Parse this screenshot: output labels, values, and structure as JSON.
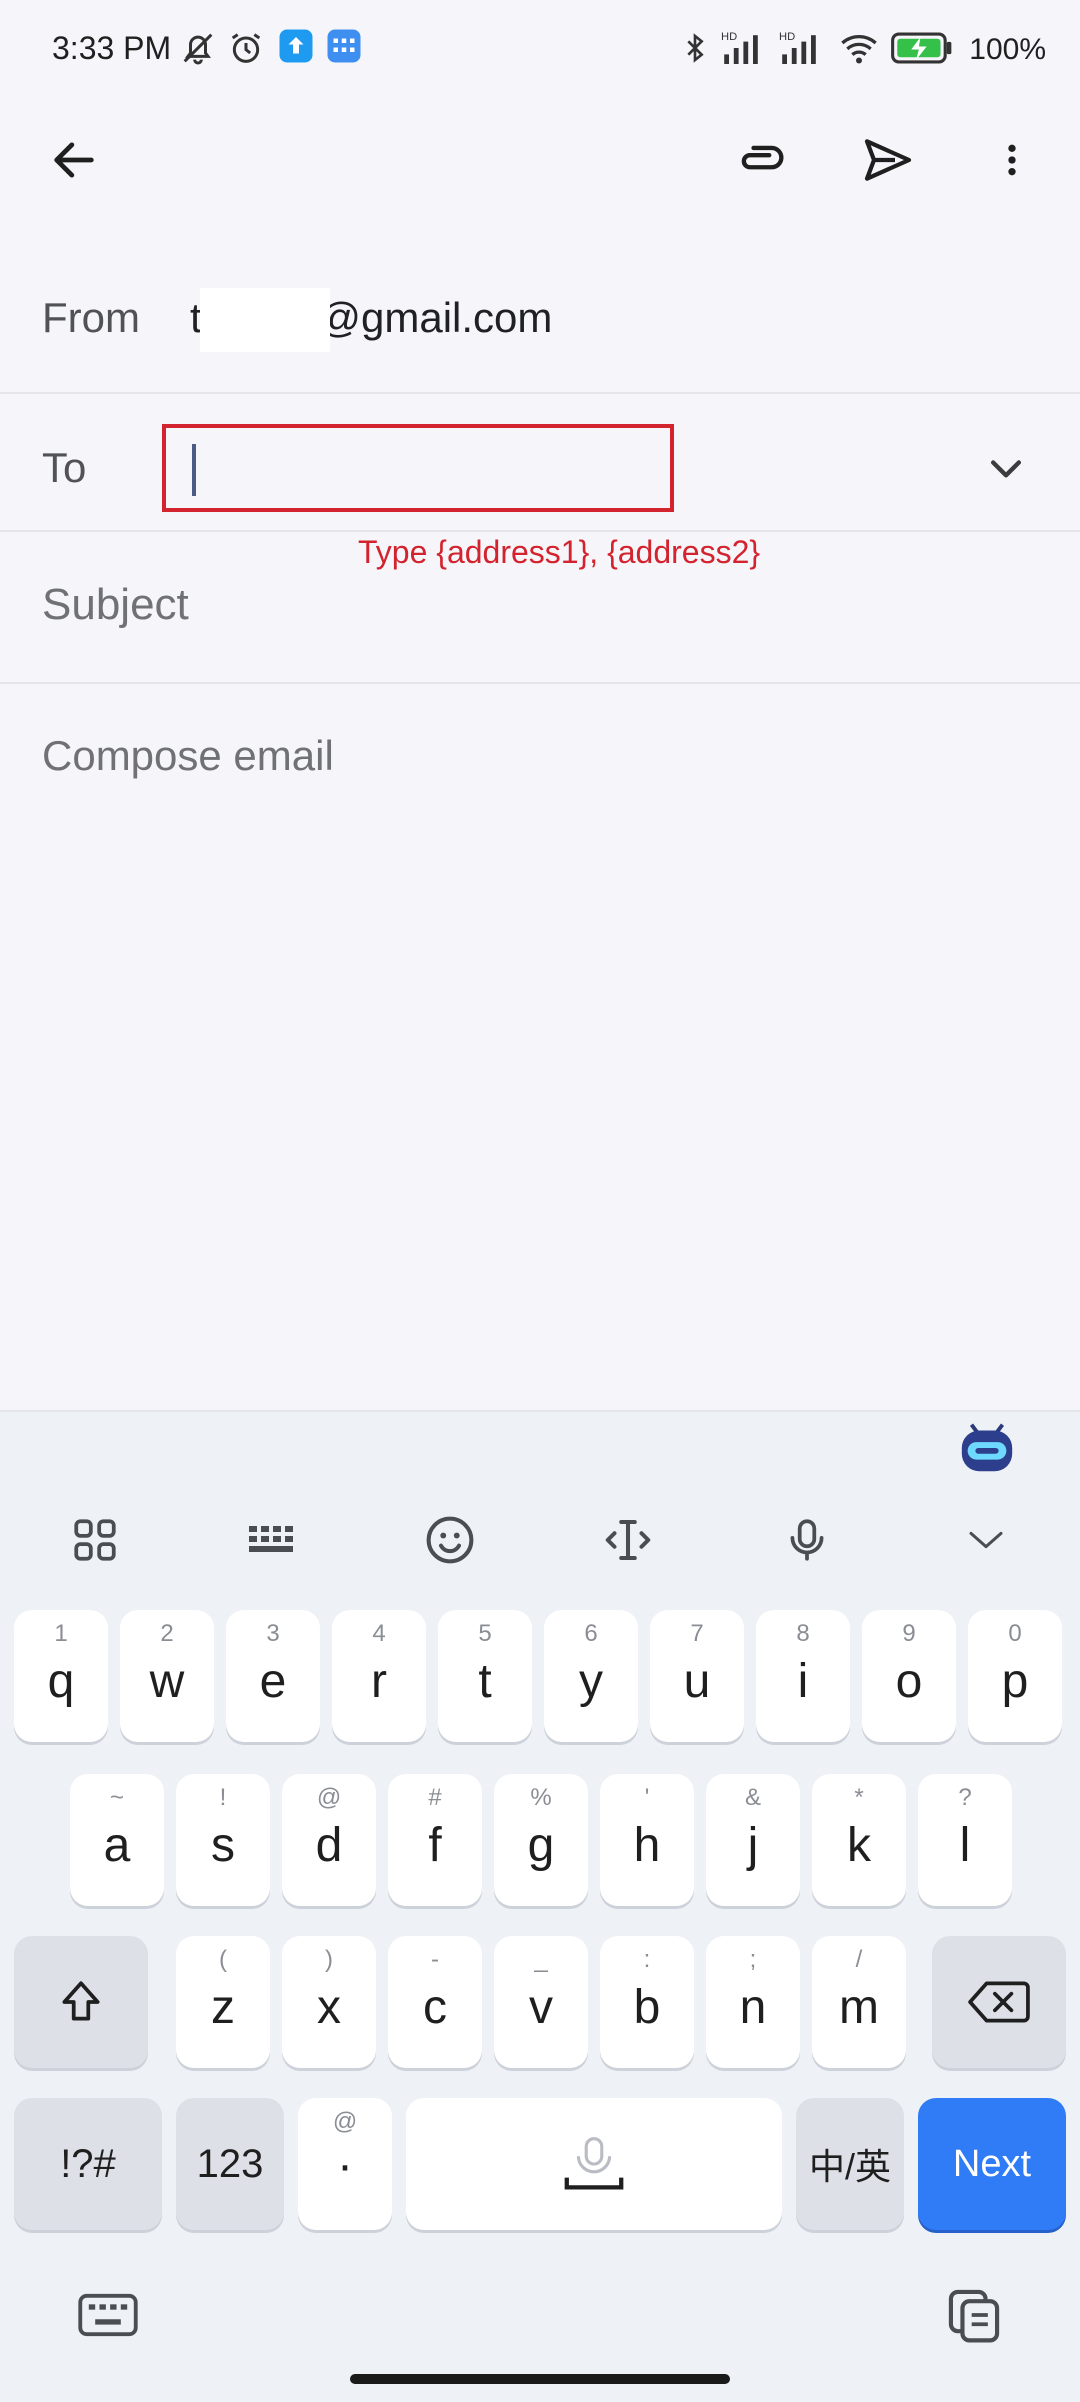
{
  "status_bar": {
    "time": "3:33 PM",
    "battery": "100%",
    "icons": [
      "mute-bell-icon",
      "alarm-icon",
      "upload-app-icon",
      "calendar-app-icon",
      "bluetooth-icon",
      "signal-hd-icon",
      "signal-hd-icon",
      "wifi-icon",
      "battery-charging-icon"
    ]
  },
  "app_bar": {
    "icons": [
      "back-arrow-icon",
      "attach-icon",
      "send-icon",
      "more-vert-icon"
    ]
  },
  "compose": {
    "from_label": "From",
    "from_value": "t        7@gmail.com",
    "to_label": "To",
    "to_value": "",
    "annotation": "Type {address1}, {address2}",
    "subject_placeholder": "Subject",
    "body_placeholder": "Compose email"
  },
  "keyboard": {
    "toolbar": [
      "apps-grid-icon",
      "keyboard-layout-icon",
      "emoji-icon",
      "text-cursor-icon",
      "microphone-icon",
      "collapse-chevron-icon"
    ],
    "row1": [
      {
        "k": "q",
        "h": "1"
      },
      {
        "k": "w",
        "h": "2"
      },
      {
        "k": "e",
        "h": "3"
      },
      {
        "k": "r",
        "h": "4"
      },
      {
        "k": "t",
        "h": "5"
      },
      {
        "k": "y",
        "h": "6"
      },
      {
        "k": "u",
        "h": "7"
      },
      {
        "k": "i",
        "h": "8"
      },
      {
        "k": "o",
        "h": "9"
      },
      {
        "k": "p",
        "h": "0"
      }
    ],
    "row2": [
      {
        "k": "a",
        "h": "~"
      },
      {
        "k": "s",
        "h": "!"
      },
      {
        "k": "d",
        "h": "@"
      },
      {
        "k": "f",
        "h": "#"
      },
      {
        "k": "g",
        "h": "%"
      },
      {
        "k": "h",
        "h": "'"
      },
      {
        "k": "j",
        "h": "&"
      },
      {
        "k": "k",
        "h": "*"
      },
      {
        "k": "l",
        "h": "?"
      }
    ],
    "row3": [
      {
        "k": "z",
        "h": "("
      },
      {
        "k": "x",
        "h": ")"
      },
      {
        "k": "c",
        "h": "-"
      },
      {
        "k": "v",
        "h": "_"
      },
      {
        "k": "b",
        "h": ":"
      },
      {
        "k": "n",
        "h": ";"
      },
      {
        "k": "m",
        "h": "/"
      }
    ],
    "symbols_label": "!?#",
    "numbers_label": "123",
    "period_hint": "@",
    "period_label": "·",
    "lang_label": "中/英",
    "next_label": "Next",
    "accent_color": "#2f7cf6"
  }
}
